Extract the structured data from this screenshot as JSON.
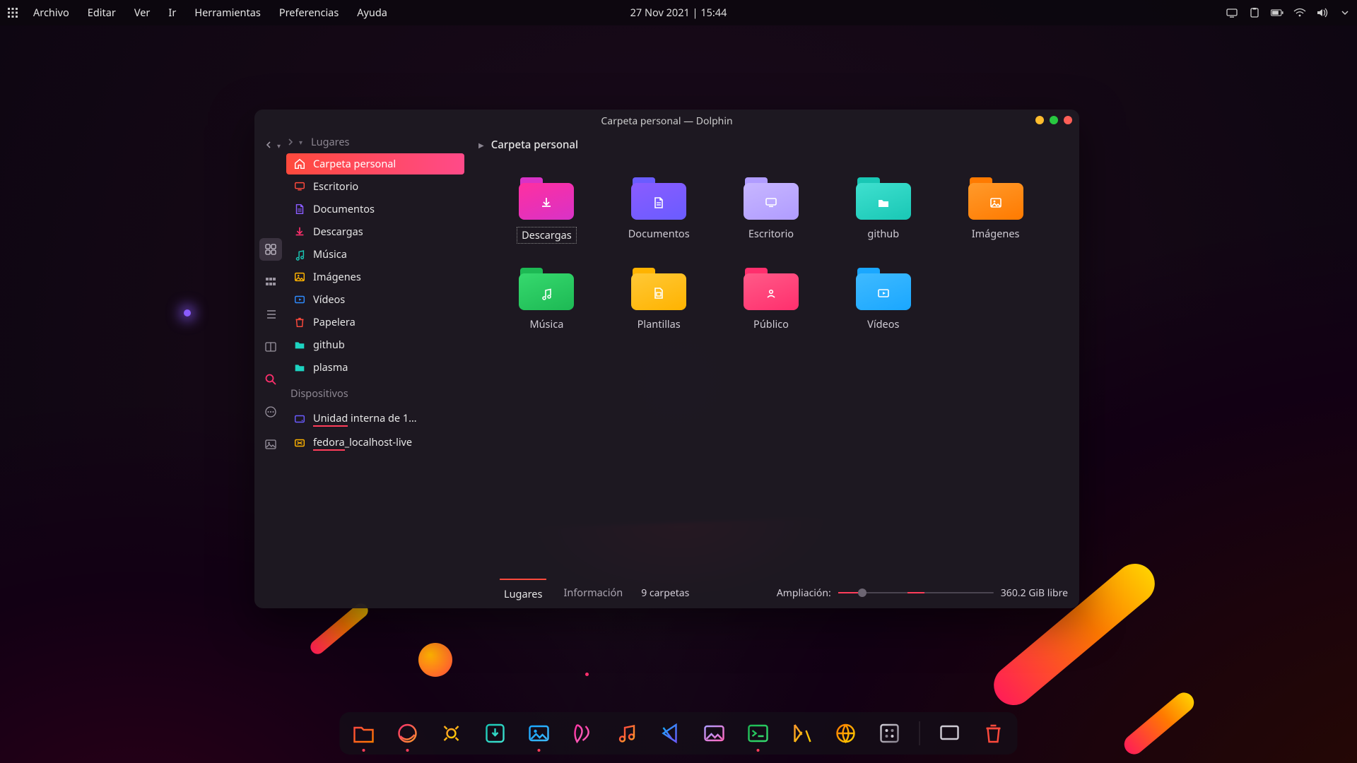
{
  "top_panel": {
    "menus": [
      "Archivo",
      "Editar",
      "Ver",
      "Ir",
      "Herramientas",
      "Preferencias",
      "Ayuda"
    ],
    "datetime": "27 Nov 2021 | 15:44"
  },
  "window": {
    "title": "Carpeta personal — Dolphin",
    "path_label": "Carpeta personal",
    "sidebar": {
      "places_header": "Lugares",
      "places": [
        {
          "label": "Carpeta personal",
          "icon": "home",
          "color": "#ffffff",
          "selected": true
        },
        {
          "label": "Escritorio",
          "icon": "desktop",
          "color": "#ff4a3c"
        },
        {
          "label": "Documentos",
          "icon": "document",
          "color": "#8a5cff"
        },
        {
          "label": "Descargas",
          "icon": "download",
          "color": "#ff2f6d"
        },
        {
          "label": "Música",
          "icon": "music",
          "color": "#19c7b5"
        },
        {
          "label": "Imágenes",
          "icon": "image",
          "color": "#ffb300"
        },
        {
          "label": "Vídeos",
          "icon": "video",
          "color": "#2e8bff"
        },
        {
          "label": "Papelera",
          "icon": "trash",
          "color": "#ff4a3c"
        },
        {
          "label": "github",
          "icon": "folder",
          "color": "#1dd3c1"
        },
        {
          "label": "plasma",
          "icon": "folder",
          "color": "#1dd3c1"
        }
      ],
      "devices_header": "Dispositivos",
      "devices": [
        {
          "label": "Unidad interna de 1…",
          "icon": "drive",
          "color": "#6a5bff",
          "underline": true
        },
        {
          "label": "fedora_localhost-live",
          "icon": "drive-live",
          "color": "#ffb300",
          "underline": true
        }
      ]
    },
    "folders": [
      {
        "label": "Descargas",
        "icon": "download",
        "c1": "#d832c7",
        "c2": "#ff2fa0",
        "selected": true
      },
      {
        "label": "Documentos",
        "icon": "document",
        "c1": "#6a5cff",
        "c2": "#8a5cff"
      },
      {
        "label": "Escritorio",
        "icon": "desktop",
        "c1": "#b09cff",
        "c2": "#c7b6ff"
      },
      {
        "label": "github",
        "icon": "folder",
        "c1": "#19c7b5",
        "c2": "#3fe0cf"
      },
      {
        "label": "Imágenes",
        "icon": "image",
        "c1": "#ff7a00",
        "c2": "#ff9a2b"
      },
      {
        "label": "Música",
        "icon": "music",
        "c1": "#1db954",
        "c2": "#36d96e"
      },
      {
        "label": "Plantillas",
        "icon": "template",
        "c1": "#ffb300",
        "c2": "#ffc836"
      },
      {
        "label": "Público",
        "icon": "public",
        "c1": "#ff2f6d",
        "c2": "#ff5a88"
      },
      {
        "label": "Vídeos",
        "icon": "video",
        "c1": "#1aa7ff",
        "c2": "#3fbaff"
      }
    ],
    "bottom_tabs": {
      "places": "Lugares",
      "info": "Información",
      "active": "places"
    },
    "status_count": "9 carpetas",
    "zoom_label": "Ampliación:",
    "free_space": "360.2 GiB libre"
  },
  "dock": {
    "apps": [
      {
        "name": "files",
        "color1": "#ff4a3c",
        "color2": "#ff7a00",
        "running": true
      },
      {
        "name": "firefox",
        "color1": "#ff2f6d",
        "color2": "#ff9a2b",
        "running": true
      },
      {
        "name": "settings",
        "color1": "#ff9a2b",
        "color2": "#ffd000",
        "running": false
      },
      {
        "name": "app-install",
        "color1": "#19c7b5",
        "color2": "#3fe0cf",
        "running": false
      },
      {
        "name": "photos",
        "color1": "#1aa7ff",
        "color2": "#3fbaff",
        "running": true
      },
      {
        "name": "kate",
        "color1": "#ff2fa0",
        "color2": "#ff6ac0",
        "running": false
      },
      {
        "name": "music",
        "color1": "#ff4a3c",
        "color2": "#ff9a2b",
        "running": false
      },
      {
        "name": "vscode",
        "color1": "#1aa7ff",
        "color2": "#6a5cff",
        "running": false
      },
      {
        "name": "gimp",
        "color1": "#b09cff",
        "color2": "#ff6ac0",
        "running": false
      },
      {
        "name": "terminal",
        "color1": "#1db954",
        "color2": "#36d96e",
        "running": true
      },
      {
        "name": "kvantum",
        "color1": "#ff9a2b",
        "color2": "#ffd000",
        "running": false
      },
      {
        "name": "browser-alt",
        "color1": "#ff7a00",
        "color2": "#ffd000",
        "running": false
      },
      {
        "name": "krita",
        "color1": "#cfcbd4",
        "color2": "#8a8490",
        "running": false
      }
    ],
    "right": [
      {
        "name": "show-desktop",
        "color": "#cfcbd4"
      },
      {
        "name": "trash",
        "color": "#ff4a3c"
      }
    ]
  }
}
